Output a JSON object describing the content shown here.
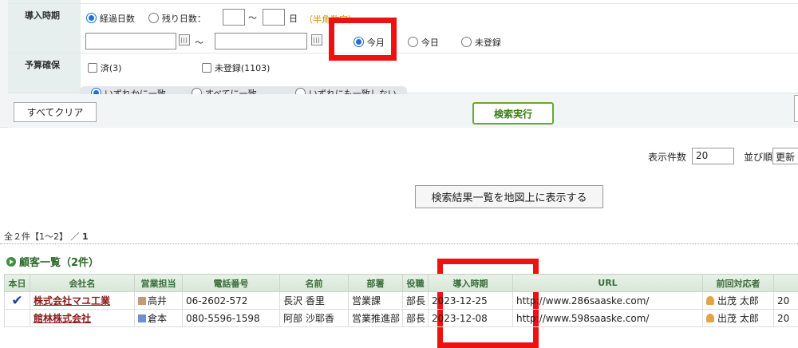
{
  "search": {
    "intro_label": "導入時期",
    "radio_elapsed": "経過日数",
    "radio_remaining": "残り日数：",
    "tilde": "～",
    "day_unit": "日",
    "halfwidth_note": "（半角数字）",
    "radio_this_month": "今月",
    "radio_today": "今日",
    "radio_unregistered": "未登録",
    "budget_label": "予算確保",
    "check_done": "済(3)",
    "check_unregistered": "未登録(1103)",
    "match_any": "いずれかに一致",
    "match_all": "すべてに一致",
    "match_none": "いずれにも一致しない",
    "clear_button": "すべてクリア",
    "search_button": "検索実行"
  },
  "list_controls": {
    "count_label": "表示件数",
    "count_value": "20",
    "sort_label": "並び順",
    "sort_value": "更新",
    "map_button": "検索結果一覧を地図上に表示する"
  },
  "summary": {
    "prefix": "全２件【1～2】",
    "slash": "／",
    "page": "1"
  },
  "list": {
    "title": "顧客一覧（2件）",
    "columns": [
      "本日",
      "会社名",
      "営業担当",
      "電話番号",
      "名前",
      "部署",
      "役職",
      "導入時期",
      "URL",
      "前回対応者",
      ""
    ],
    "rows": [
      {
        "today": "✔",
        "company": "株式会社マユ工業",
        "rep": "高井",
        "rep_color": "#c9987a",
        "phone": "06-2602-572",
        "name": "長沢 香里",
        "dept": "営業課",
        "title": "部長",
        "intro": "2023-12-25",
        "url": "http://www.286saaske.com/",
        "last_contact": "出茂 太郎",
        "extra": "20"
      },
      {
        "today": "",
        "company": "館林株式会社",
        "rep": "倉本",
        "rep_color": "#6b8fd1",
        "phone": "080-5596-1598",
        "name": "阿部 沙耶香",
        "dept": "営業推進部",
        "title": "部長",
        "intro": "2023-12-08",
        "url": "http://www.598saaske.com/",
        "last_contact": "出茂 太郎",
        "extra": "20"
      }
    ]
  },
  "colors": {
    "highlight": "#ee1111",
    "header_green": "#3a6e3a",
    "company_link": "#8b1a1a",
    "search_button": "#6aa82f"
  }
}
